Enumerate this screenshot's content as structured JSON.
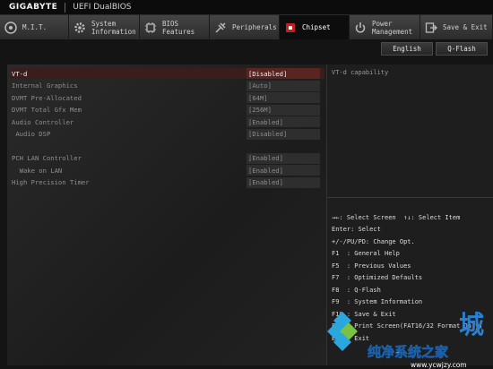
{
  "brand": "GIGABYTE",
  "bios_name": "UEFI DualBIOS",
  "tabs": [
    {
      "label": "M.I.T.",
      "icon": "gauge-icon"
    },
    {
      "label": "System\nInformation",
      "icon": "gear-icon"
    },
    {
      "label": "BIOS\nFeatures",
      "icon": "chip-icon"
    },
    {
      "label": "Peripherals",
      "icon": "plug-icon"
    },
    {
      "label": "Chipset",
      "icon": "chipset-icon",
      "active": true
    },
    {
      "label": "Power\nManagement",
      "icon": "power-icon"
    },
    {
      "label": "Save & Exit",
      "icon": "exit-icon"
    }
  ],
  "buttons": {
    "language": "English",
    "qflash": "Q-Flash"
  },
  "settings": [
    {
      "label": "VT-d",
      "value": "[Disabled]",
      "selected": true
    },
    {
      "label": "Internal Graphics",
      "value": "[Auto]"
    },
    {
      "label": "DVMT Pre-Allocated",
      "value": "[64M]"
    },
    {
      "label": "DVMT Total Gfx Mem",
      "value": "[256M]"
    },
    {
      "label": "Audio Controller",
      "value": "[Enabled]"
    },
    {
      "label": " Audio DSP",
      "value": "[Disabled]"
    },
    {
      "label": "PCH LAN Controller",
      "value": "[Enabled]"
    },
    {
      "label": "  Wake on LAN",
      "value": "[Enabled]"
    },
    {
      "label": "High Precision Timer",
      "value": "[Enabled]"
    }
  ],
  "help": {
    "description": "VT-d capability",
    "keys": [
      "→←: Select Screen  ↑↓: Select Item",
      "Enter: Select",
      "+/-/PU/PD: Change Opt.",
      "F1  : General Help",
      "F5  : Previous Values",
      "F7  : Optimized Defaults",
      "F8  : Q-Flash",
      "F9  : System Information",
      "F10 : Save & Exit",
      "F12 : Print Screen(FAT16/32 Format Only)",
      "ESC : Exit"
    ]
  },
  "watermark": {
    "brand_char": "城",
    "text": "纯净系统之家",
    "url": "www.ycwjzy.com"
  },
  "colors": {
    "accent": "#c41e1e",
    "selected_row": "#3a1e1c",
    "selected_value": "#5a2520"
  }
}
